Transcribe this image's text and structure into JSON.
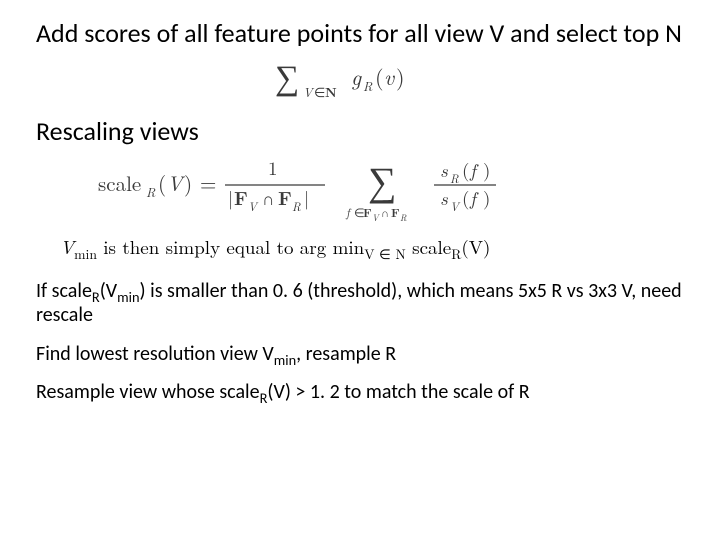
{
  "heading": "Add scores of all feature points for all view V and select top N",
  "formula1_alt": "sum over V in N of g_R(v)",
  "subheading": "Rescaling views",
  "formula2_alt": "scale_R(V) = (1 / |F_V ∩ F_R|) * sum over f in F_V ∩ F_R of s_R(f) / s_V(f)",
  "statement_prefix": "V",
  "statement_sub": "min",
  "statement_mid": " is then simply equal to ",
  "statement_argmin": "arg min",
  "statement_argmin_sub": "V ∈ N",
  "statement_tail": " scale",
  "statement_tail_sub": "R",
  "statement_tail_end": "(V)",
  "p1_a": "If scale",
  "p1_sub1": "R",
  "p1_b": "(V",
  "p1_sub2": "min",
  "p1_c": ") is smaller than 0. 6 (threshold), which means 5x5 R vs 3x3 V, need rescale",
  "p2_a": "Find lowest resolution view V",
  "p2_sub": "min",
  "p2_b": ", resample R",
  "p3_a": "Resample view whose scale",
  "p3_sub": "R",
  "p3_b": "(V) > 1. 2 to match the scale of R"
}
